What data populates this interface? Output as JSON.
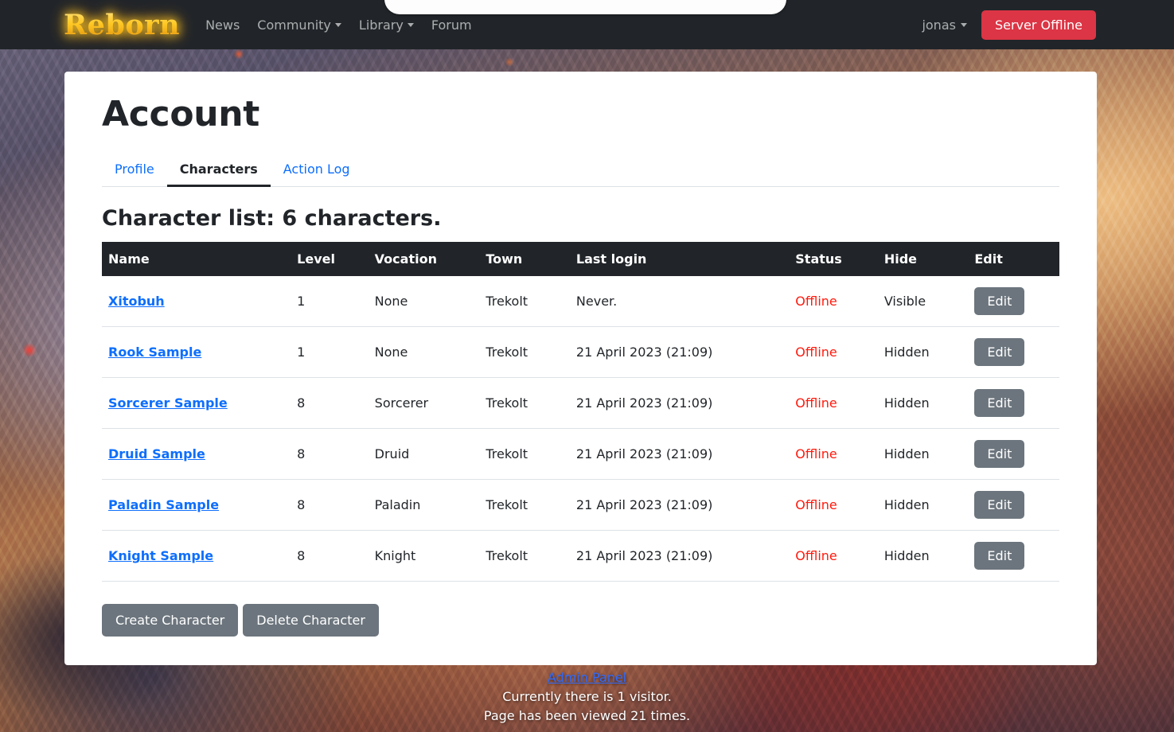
{
  "navbar": {
    "logo": "Reborn",
    "links": [
      {
        "label": "News",
        "has_caret": false
      },
      {
        "label": "Community",
        "has_caret": true
      },
      {
        "label": "Library",
        "has_caret": true
      },
      {
        "label": "Forum",
        "has_caret": false
      }
    ],
    "user": "jonas",
    "server_status": "Server Offline",
    "server_status_color": "#dc3545",
    "background_color": "#212529"
  },
  "page": {
    "title": "Account"
  },
  "tabs": [
    {
      "label": "Profile",
      "active": false
    },
    {
      "label": "Characters",
      "active": true
    },
    {
      "label": "Action Log",
      "active": false
    }
  ],
  "characters_section": {
    "heading": "Character list: 6 characters.",
    "columns": [
      "Name",
      "Level",
      "Vocation",
      "Town",
      "Last login",
      "Status",
      "Hide",
      "Edit"
    ],
    "rows": [
      {
        "name": "Xitobuh",
        "level": "1",
        "vocation": "None",
        "town": "Trekolt",
        "last_login": "Never.",
        "status": "Offline",
        "hide": "Visible",
        "edit_label": "Edit"
      },
      {
        "name": "Rook Sample",
        "level": "1",
        "vocation": "None",
        "town": "Trekolt",
        "last_login": "21 April 2023 (21:09)",
        "status": "Offline",
        "hide": "Hidden",
        "edit_label": "Edit"
      },
      {
        "name": "Sorcerer Sample",
        "level": "8",
        "vocation": "Sorcerer",
        "town": "Trekolt",
        "last_login": "21 April 2023 (21:09)",
        "status": "Offline",
        "hide": "Hidden",
        "edit_label": "Edit"
      },
      {
        "name": "Druid Sample",
        "level": "8",
        "vocation": "Druid",
        "town": "Trekolt",
        "last_login": "21 April 2023 (21:09)",
        "status": "Offline",
        "hide": "Hidden",
        "edit_label": "Edit"
      },
      {
        "name": "Paladin Sample",
        "level": "8",
        "vocation": "Paladin",
        "town": "Trekolt",
        "last_login": "21 April 2023 (21:09)",
        "status": "Offline",
        "hide": "Hidden",
        "edit_label": "Edit"
      },
      {
        "name": "Knight Sample",
        "level": "8",
        "vocation": "Knight",
        "town": "Trekolt",
        "last_login": "21 April 2023 (21:09)",
        "status": "Offline",
        "hide": "Hidden",
        "edit_label": "Edit"
      }
    ],
    "status_color": "#ff1a0d",
    "link_color": "#0d6efd",
    "header_bg": "#212529"
  },
  "actions": {
    "create_label": "Create Character",
    "delete_label": "Delete Character"
  },
  "footer": {
    "admin_link": "Admin Panel",
    "visitors_line": "Currently there is 1 visitor.",
    "views_line": "Page has been viewed 21 times."
  }
}
